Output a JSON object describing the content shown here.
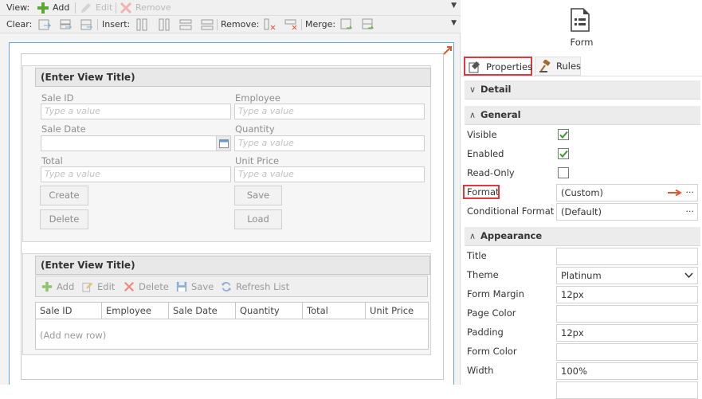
{
  "toolbar_view": {
    "label": "View:",
    "add": "Add",
    "edit": "Edit",
    "remove": "Remove"
  },
  "toolbar_layout": {
    "clear": "Clear:",
    "insert": "Insert:",
    "remove": "Remove:",
    "merge": "Merge:"
  },
  "view1": {
    "title": "(Enter View Title)",
    "fields": {
      "sale_id": {
        "label": "Sale ID",
        "placeholder": "Type a value"
      },
      "employee": {
        "label": "Employee",
        "placeholder": "Type a value"
      },
      "sale_date": {
        "label": "Sale Date",
        "placeholder": ""
      },
      "quantity": {
        "label": "Quantity",
        "placeholder": "Type a value"
      },
      "total": {
        "label": "Total",
        "placeholder": "Type a value"
      },
      "unit_price": {
        "label": "Unit Price",
        "placeholder": "Type a value"
      }
    },
    "buttons": {
      "create": "Create",
      "save": "Save",
      "delete": "Delete",
      "load": "Load"
    }
  },
  "view2": {
    "title": "(Enter View Title)",
    "toolbar": {
      "add": "Add",
      "edit": "Edit",
      "delete": "Delete",
      "save": "Save",
      "refresh": "Refresh List"
    },
    "columns": [
      "Sale ID",
      "Employee",
      "Sale Date",
      "Quantity",
      "Total",
      "Unit Price"
    ],
    "empty_row": "(Add new row)"
  },
  "panel": {
    "object_label": "Form",
    "tabs": {
      "properties": "Properties",
      "rules": "Rules"
    },
    "sections": {
      "detail": "Detail",
      "general": "General",
      "appearance": "Appearance"
    },
    "general": {
      "visible": {
        "label": "Visible",
        "checked": true
      },
      "enabled": {
        "label": "Enabled",
        "checked": true
      },
      "read_only": {
        "label": "Read-Only",
        "checked": false
      },
      "format": {
        "label": "Format",
        "value": "(Custom)"
      },
      "conditional_format": {
        "label": "Conditional Format",
        "value": "(Default)"
      }
    },
    "appearance": {
      "title": {
        "label": "Title",
        "value": ""
      },
      "theme": {
        "label": "Theme",
        "value": "Platinum"
      },
      "form_margin": {
        "label": "Form Margin",
        "value": "12px"
      },
      "page_color": {
        "label": "Page Color",
        "value": ""
      },
      "padding": {
        "label": "Padding",
        "value": "12px"
      },
      "form_color": {
        "label": "Form Color",
        "value": ""
      },
      "width": {
        "label": "Width",
        "value": "100%"
      }
    },
    "ellipsis": "···"
  },
  "colors": {
    "accent_red": "#e0383e",
    "check_green": "#3a9a2c",
    "add_green": "#5aa832",
    "delete_red": "#e05545",
    "canvas_border": "#6aa5d8"
  }
}
